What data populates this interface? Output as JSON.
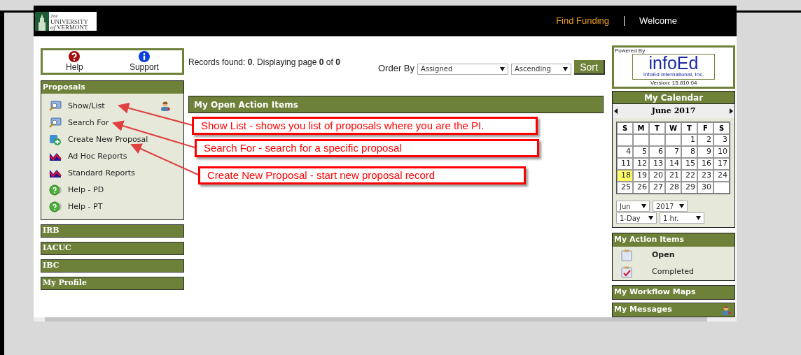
{
  "header": {
    "logo_lines": [
      "The",
      "UNIVERSITY",
      "*of* VERMONT"
    ],
    "links": [
      "Find Funding",
      "Welcome"
    ]
  },
  "quick_links": [
    {
      "label": "Help",
      "kind": "help"
    },
    {
      "label": "Support",
      "kind": "info"
    }
  ],
  "proposals": {
    "title": "Proposals",
    "items": [
      {
        "label": "Show/List",
        "kind": "monitor",
        "people_icon": true
      },
      {
        "label": "Search For",
        "kind": "monitor",
        "people_icon": false
      },
      {
        "label": "Create New Proposal",
        "kind": "add",
        "people_icon": false
      },
      {
        "label": "Ad Hoc Reports",
        "kind": "report",
        "people_icon": false
      },
      {
        "label": "Standard Reports",
        "kind": "report",
        "people_icon": false
      },
      {
        "label": "Help - PD",
        "kind": "help",
        "people_icon": false
      },
      {
        "label": "Help - PT",
        "kind": "help",
        "people_icon": false
      }
    ]
  },
  "modules": [
    "IRB",
    "IACUC",
    "IBC",
    "My Profile"
  ],
  "records": {
    "text": "Records found: **0**. Displaying page **0** of **0**",
    "order_label": "Order By",
    "order_field": "Assigned",
    "direction": "Ascending",
    "sort_button": "Sort"
  },
  "open_action_items": {
    "title": "My Open Action Items"
  },
  "callouts": [
    "Show List - shows you list of proposals where you are the PI.",
    "Search For - search for a specific proposal",
    "Create New Proposal - start new proposal record"
  ],
  "powered_by": {
    "label": "Powered By",
    "logo": "infoEd",
    "company": "InfoEd International, Inc.",
    "version": "Version: 15.810.04"
  },
  "calendar": {
    "title": "My Calendar",
    "month": "June 2017",
    "weekdays": [
      "S",
      "M",
      "T",
      "W",
      "T",
      "F",
      "S"
    ],
    "weeks": [
      [
        {
          "kind": "empty"
        },
        {
          "kind": "empty"
        },
        {
          "kind": "empty"
        },
        {
          "kind": "empty"
        },
        {
          "kind": "day",
          "day": "1",
          "selected": false
        },
        {
          "kind": "day",
          "day": "2",
          "selected": false
        },
        {
          "kind": "day",
          "day": "3",
          "selected": false
        }
      ],
      [
        {
          "kind": "day",
          "day": "4",
          "selected": false
        },
        {
          "kind": "day",
          "day": "5",
          "selected": false
        },
        {
          "kind": "day",
          "day": "6",
          "selected": false
        },
        {
          "kind": "day",
          "day": "7",
          "selected": false
        },
        {
          "kind": "day",
          "day": "8",
          "selected": false
        },
        {
          "kind": "day",
          "day": "9",
          "selected": false
        },
        {
          "kind": "day",
          "day": "10",
          "selected": false
        }
      ],
      [
        {
          "kind": "day",
          "day": "11",
          "selected": false
        },
        {
          "kind": "day",
          "day": "12",
          "selected": false
        },
        {
          "kind": "day",
          "day": "13",
          "selected": false
        },
        {
          "kind": "day",
          "day": "14",
          "selected": false
        },
        {
          "kind": "day",
          "day": "15",
          "selected": false
        },
        {
          "kind": "day",
          "day": "16",
          "selected": false
        },
        {
          "kind": "day",
          "day": "17",
          "selected": false
        }
      ],
      [
        {
          "kind": "day",
          "day": "18",
          "selected": true
        },
        {
          "kind": "day",
          "day": "19",
          "selected": false
        },
        {
          "kind": "day",
          "day": "20",
          "selected": false
        },
        {
          "kind": "day",
          "day": "21",
          "selected": false
        },
        {
          "kind": "day",
          "day": "22",
          "selected": false
        },
        {
          "kind": "day",
          "day": "23",
          "selected": false
        },
        {
          "kind": "day",
          "day": "24",
          "selected": false
        }
      ],
      [
        {
          "kind": "day",
          "day": "25",
          "selected": false
        },
        {
          "kind": "day",
          "day": "26",
          "selected": false
        },
        {
          "kind": "day",
          "day": "27",
          "selected": false
        },
        {
          "kind": "day",
          "day": "28",
          "selected": false
        },
        {
          "kind": "day",
          "day": "29",
          "selected": false
        },
        {
          "kind": "day",
          "day": "30",
          "selected": false
        },
        {
          "kind": "empty"
        }
      ]
    ],
    "month_select": "Jun",
    "year_select": "2017",
    "view_select": "1-Day",
    "interval_select": "1 hr."
  },
  "action_items": {
    "title": "My Action Items",
    "items": [
      {
        "label": "Open",
        "kind": "open",
        "emphasized": true
      },
      {
        "label": "Completed",
        "kind": "done",
        "emphasized": false
      }
    ]
  },
  "side_panels": [
    {
      "title": "My Workflow Maps",
      "people_icon": false
    },
    {
      "title": "My Messages",
      "people_icon": true
    }
  ]
}
